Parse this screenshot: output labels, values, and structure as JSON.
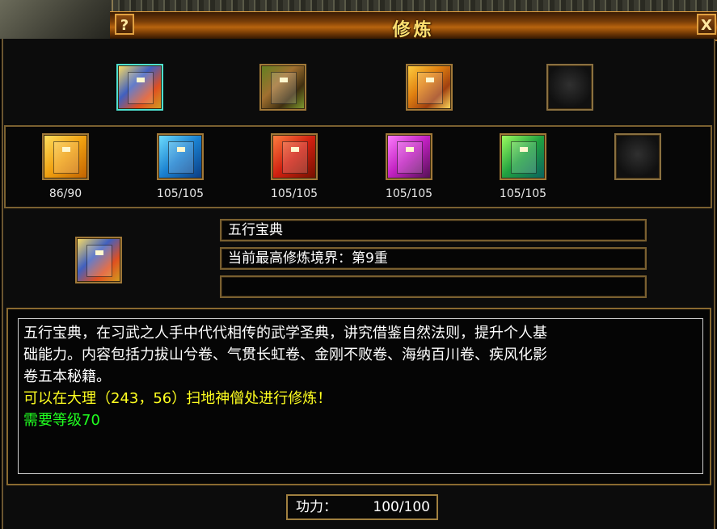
{
  "window": {
    "title": "修炼",
    "help_label": "?",
    "close_label": "X"
  },
  "top_row": [
    {
      "icon": "five-elements-book-icon",
      "selected": true
    },
    {
      "icon": "bamboo-scroll-icon",
      "selected": false
    },
    {
      "icon": "golden-scroll-stack-icon",
      "selected": false
    },
    {
      "icon": "empty-slot-icon",
      "selected": false
    }
  ],
  "books": [
    {
      "icon": "gold-book-icon",
      "count": "86/90"
    },
    {
      "icon": "blue-book-icon",
      "count": "105/105"
    },
    {
      "icon": "red-book-icon",
      "count": "105/105"
    },
    {
      "icon": "pink-book-icon",
      "count": "105/105"
    },
    {
      "icon": "green-book-icon",
      "count": "105/105"
    },
    {
      "icon": "empty-slot-icon",
      "count": ""
    }
  ],
  "info": {
    "name": "五行宝典",
    "realm": "当前最高修炼境界：第9重",
    "extra": ""
  },
  "description": {
    "line1": "五行宝典，在习武之人手中代代相传的武学圣典，讲究借鉴自然法则，提升个人基",
    "line2": "础能力。内容包括力拔山兮卷、气贯长虹卷、金刚不败卷、海纳百川卷、疾风化影",
    "line3": "卷五本秘籍。",
    "location": "可以在大理（243，56）扫地神僧处进行修炼！",
    "requirement": "需要等级70"
  },
  "power": {
    "label": "功力：",
    "value": "100/100"
  },
  "colors": {
    "title": "#ffe070",
    "location_text": "#ffff20",
    "requirement_text": "#20ff20",
    "frame": "#a07838",
    "selected_frame": "#4de0d0"
  }
}
